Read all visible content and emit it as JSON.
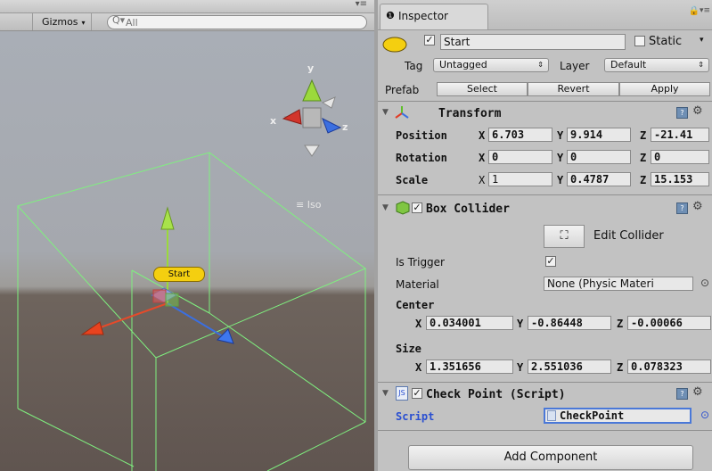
{
  "scene": {
    "menu_glyph": "▾≡",
    "gizmos_label": "Gizmos",
    "search_prefix": "Q▾",
    "search_placeholder": "All",
    "iso_label": "≡ Iso",
    "axis_y": "y",
    "axis_x": "x",
    "axis_z": "z",
    "object_label": "Start"
  },
  "inspector": {
    "tab_title": "Inspector",
    "header": {
      "name": "Start",
      "active_checked": true,
      "static_label": "Static",
      "static_checked": false,
      "tag_label": "Tag",
      "tag_value": "Untagged",
      "layer_label": "Layer",
      "layer_value": "Default",
      "prefab_label": "Prefab",
      "select_label": "Select",
      "revert_label": "Revert",
      "apply_label": "Apply"
    },
    "transform": {
      "title": "Transform",
      "position_label": "Position",
      "rotation_label": "Rotation",
      "scale_label": "Scale",
      "position": {
        "x": "6.703",
        "y": "9.914",
        "z": "-21.41"
      },
      "rotation": {
        "x": "0",
        "y": "0",
        "z": "0"
      },
      "scale": {
        "x": "1",
        "y": "0.4787",
        "z": "15.153"
      }
    },
    "box_collider": {
      "title": "Box Collider",
      "enabled": true,
      "edit_collider_label": "Edit Collider",
      "is_trigger_label": "Is Trigger",
      "is_trigger_checked": true,
      "material_label": "Material",
      "material_value": "None (Physic Materi",
      "center_label": "Center",
      "center": {
        "x": "0.034001",
        "y": "-0.86448",
        "z": "-0.00066"
      },
      "size_label": "Size",
      "size": {
        "x": "1.351656",
        "y": "2.551036",
        "z": "0.078323"
      }
    },
    "check_point": {
      "title": "Check Point (Script)",
      "enabled": true,
      "script_label": "Script",
      "script_value": "CheckPoint"
    },
    "add_component_label": "Add Component"
  },
  "colors": {
    "accent": "#2a4fd1",
    "label_yellow": "#f4cf10",
    "bounds_green": "#7ff07f"
  }
}
